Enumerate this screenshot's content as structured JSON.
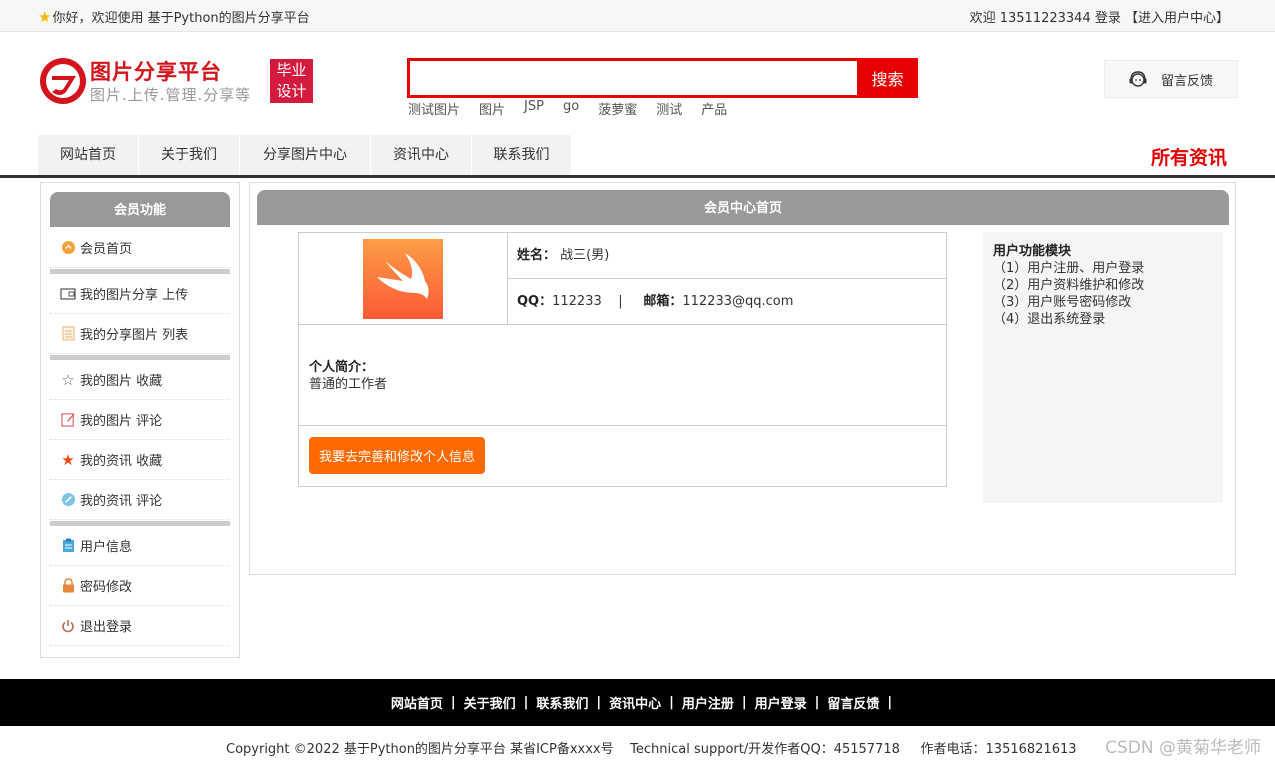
{
  "topbar": {
    "welcome": "你好，欢迎使用 基于Python的图片分享平台",
    "userinfo": "欢迎 13511223344 登录 【进入用户中心】"
  },
  "header": {
    "site_name": "图片分享平台",
    "slogan": "图片.上传.管理.分享等",
    "badge_line1": "毕业",
    "badge_line2": "设计",
    "search_value": "",
    "search_button": "搜索",
    "hot_words": [
      "测试图片",
      "图片",
      "JSP",
      "go",
      "菠萝蜜",
      "测试",
      "产品"
    ],
    "feedback": "留言反馈"
  },
  "nav": {
    "items": [
      "网站首页",
      "关于我们",
      "分享图片中心",
      "资讯中心",
      "联系我们"
    ],
    "all_news": "所有资讯"
  },
  "sidebar": {
    "title": "会员功能",
    "items": [
      {
        "label": "会员首页",
        "icon": "home-icon"
      },
      {
        "label": "我的图片分享 上传",
        "icon": "upload-icon"
      },
      {
        "label": "我的分享图片 列表",
        "icon": "list-icon"
      },
      {
        "label": "我的图片 收藏",
        "icon": "star-outline-icon"
      },
      {
        "label": "我的图片 评论",
        "icon": "edit-icon"
      },
      {
        "label": "我的资讯 收藏",
        "icon": "star-icon"
      },
      {
        "label": "我的资讯 评论",
        "icon": "comment-icon"
      },
      {
        "label": "用户信息",
        "icon": "clipboard-icon"
      },
      {
        "label": "密码修改",
        "icon": "lock-icon"
      },
      {
        "label": "退出登录",
        "icon": "power-icon"
      }
    ]
  },
  "main": {
    "title": "会员中心首页",
    "name_label": "姓名：",
    "name_value": "战三(男)",
    "qq_label": "QQ：",
    "qq_value": "112233",
    "email_label": "邮箱：",
    "email_value": "112233@qq.com",
    "intro_label": "个人简介：",
    "intro_value": "普通的工作者",
    "edit_button": "我要去完善和修改个人信息"
  },
  "functions": {
    "title": "用户功能模块",
    "items": [
      "（1）用户注册、用户登录",
      "（2）用户资料维护和修改",
      "（3）用户账号密码修改",
      "（4）退出系统登录"
    ]
  },
  "footer": {
    "links": [
      "网站首页",
      "关于我们",
      "联系我们",
      "资讯中心",
      "用户注册",
      "用户登录",
      "留言反馈"
    ],
    "copyright": "Copyright ©2022 基于Python的图片分享平台 某省ICP备xxxx号    Technical support/开发作者QQ：45157718     作者电话：13516821613",
    "watermark": "CSDN @黄菊华老师"
  },
  "colors": {
    "accent_red": "#e60000",
    "orange": "#ff6a00",
    "gray_header": "#999999"
  }
}
